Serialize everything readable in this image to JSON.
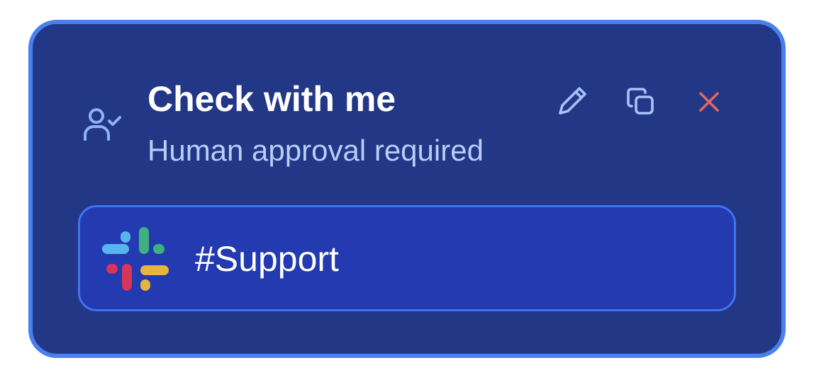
{
  "node": {
    "title": "Check with me",
    "subtitle": "Human approval required",
    "icon": "user-check-icon",
    "actions": [
      {
        "name": "edit",
        "icon": "pencil-icon"
      },
      {
        "name": "duplicate",
        "icon": "copy-icon"
      },
      {
        "name": "delete",
        "icon": "close-icon"
      }
    ]
  },
  "channel": {
    "name": "#Support",
    "icon": "slack-icon"
  },
  "colors": {
    "card_background": "#233787",
    "card_border": "#4a80ee",
    "channel_background": "#233ab0",
    "channel_border": "#3f74f0",
    "subtitle": "#b9cdf6",
    "icon_blue": "#8db4f7",
    "close_red": "#e0685e"
  }
}
